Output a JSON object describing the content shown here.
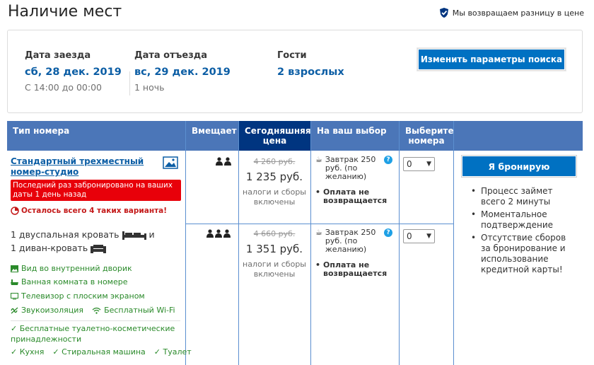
{
  "header": {
    "title": "Наличие мест",
    "price_match": "Мы возвращаем разницу в цене"
  },
  "search": {
    "checkin_label": "Дата заезда",
    "checkin_date": "сб, 28 дек. 2019",
    "checkin_time": "С 14:00 до 00:00",
    "checkout_label": "Дата отъезда",
    "checkout_date": "вс, 29 дек. 2019",
    "nights": "1 ночь",
    "guests_label": "Гости",
    "guests_value": "2 взрослых",
    "change_button": "Изменить параметры поиска"
  },
  "table": {
    "col_room_type": "Тип номера",
    "col_sleeps": "Вмещает",
    "col_today_price": "Сегодняшняя цена",
    "col_your_choice": "На ваш выбор",
    "col_select_rooms": "Выберите номера"
  },
  "room": {
    "name": "Стандартный трехместный номер-студио",
    "last_booked": "Последний раз забронировано на ваших даты 1 день назад",
    "rooms_left": "Осталось всего 4 таких варианта!",
    "bed1": "1 двуспальная кровать",
    "bed_and": "и",
    "bed2": "1 диван-кровать",
    "amenities": {
      "courtyard": "Вид во внутренний дворик",
      "bathroom": "Ванная комната в номере",
      "tv": "Телевизор с плоским экраном",
      "soundproof": "Звукоизоляция",
      "wifi": "Бесплатный Wi-Fi",
      "toiletries": "✓ Бесплатные туалетно-косметические принадлежности",
      "kitchen": "✓ Кухня",
      "washer": "✓ Стиральная машина",
      "toilet": "✓ Туалет"
    }
  },
  "offers": [
    {
      "old_price": "4 260 руб.",
      "new_price": "1 235 руб.",
      "taxes": "налоги и сборы включены",
      "breakfast": "Завтрак 250 руб. (по желанию)",
      "policy": "Оплата не возвращается",
      "qty": "0"
    },
    {
      "old_price": "4 660 руб.",
      "new_price": "1 351 руб.",
      "taxes": "налоги и сборы включены",
      "breakfast": "Завтрак 250 руб. (по желанию)",
      "policy": "Оплата не возвращается",
      "qty": "0"
    }
  ],
  "booking": {
    "button": "Я бронирую",
    "note1": "Процесс займет всего 2 минуты",
    "note2": "Моментальное подтверждение",
    "note3": "Отсутствие сборов за бронирование и использование кредитной карты!"
  },
  "colors": {
    "brand_blue": "#0071c2",
    "header_blue": "#4b76b8",
    "header_dark": "#003580",
    "link_blue": "#0c5ea5",
    "alert_red": "#e8000a",
    "amenity_green": "#2a8a2a"
  }
}
